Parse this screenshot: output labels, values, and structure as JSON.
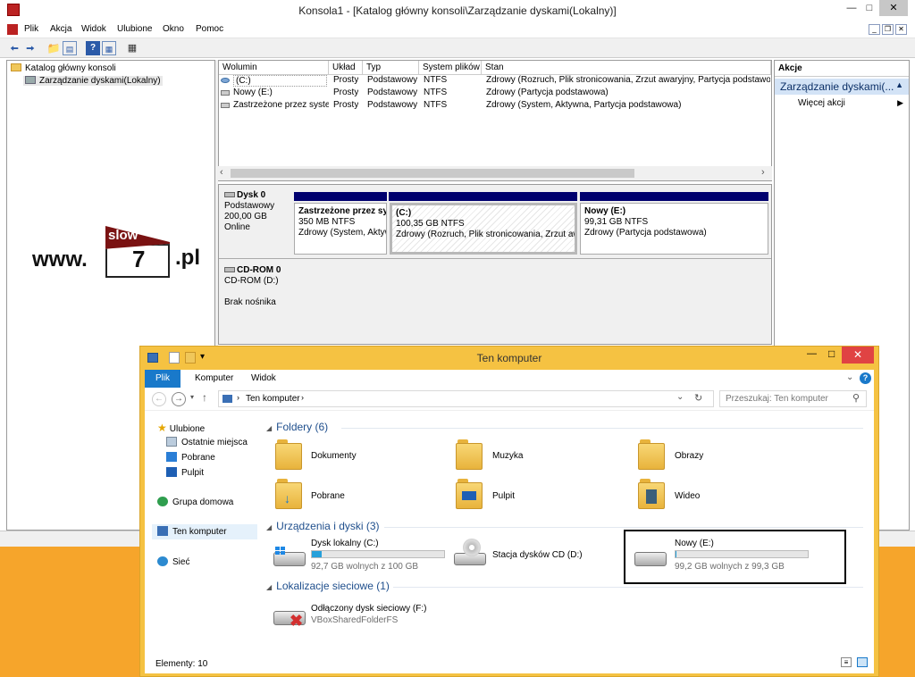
{
  "mmc": {
    "title": "Konsola1 - [Katalog główny konsoli\\Zarządzanie dyskami(Lokalny)]",
    "menu": [
      "Plik",
      "Akcja",
      "Widok",
      "Ulubione",
      "Okno",
      "Pomoc"
    ],
    "tree": {
      "root": "Katalog główny konsoli",
      "child": "Zarządzanie dyskami(Lokalny)"
    },
    "columns": [
      "Wolumin",
      "Układ",
      "Typ",
      "System plików",
      "Stan"
    ],
    "volumes": [
      {
        "name": "(C:)",
        "layout": "Prosty",
        "type": "Podstawowy",
        "fs": "NTFS",
        "status": "Zdrowy (Rozruch, Plik stronicowania, Zrzut awaryjny, Partycja podstawowa)"
      },
      {
        "name": "Nowy (E:)",
        "layout": "Prosty",
        "type": "Podstawowy",
        "fs": "NTFS",
        "status": "Zdrowy (Partycja podstawowa)"
      },
      {
        "name": "Zastrzeżone przez system",
        "layout": "Prosty",
        "type": "Podstawowy",
        "fs": "NTFS",
        "status": "Zdrowy (System, Aktywna, Partycja podstawowa)"
      }
    ],
    "disk0": {
      "name": "Dysk 0",
      "type": "Podstawowy",
      "size": "200,00 GB",
      "state": "Online",
      "partitions": [
        {
          "title": "Zastrzeżone przez sys",
          "size": "350 MB NTFS",
          "status": "Zdrowy (System, Aktyw"
        },
        {
          "title": "(C:)",
          "size": "100,35 GB NTFS",
          "status": "Zdrowy (Rozruch, Plik stronicowania, Zrzut awa"
        },
        {
          "title": "Nowy  (E:)",
          "size": "99,31 GB NTFS",
          "status": "Zdrowy (Partycja podstawowa)"
        }
      ]
    },
    "cdrom": {
      "name": "CD-ROM 0",
      "drive": "CD-ROM (D:)",
      "media": "Brak nośnika"
    },
    "actions": {
      "header": "Akcje",
      "selected": "Zarządzanie dyskami(...",
      "more": "Więcej akcji"
    }
  },
  "watermark": {
    "prefix": "www.",
    "top": "slow",
    "number": "7",
    "suffix": ".pl"
  },
  "explorer": {
    "title": "Ten komputer",
    "tabs": [
      "Plik",
      "Komputer",
      "Widok"
    ],
    "address": "Ten komputer",
    "search_placeholder": "Przeszukaj: Ten komputer",
    "nav": {
      "favorites": "Ulubione",
      "recent": "Ostatnie miejsca",
      "downloads": "Pobrane",
      "desktop": "Pulpit",
      "homegroup": "Grupa domowa",
      "thispc": "Ten komputer",
      "network": "Sieć"
    },
    "folders_header": "Foldery (6)",
    "folders": [
      "Dokumenty",
      "Muzyka",
      "Obrazy",
      "Pobrane",
      "Pulpit",
      "Wideo"
    ],
    "devices_header": "Urządzenia i dyski (3)",
    "devices": [
      {
        "name": "Dysk lokalny (C:)",
        "free": "92,7 GB wolnych z 100 GB",
        "used_fraction": 0.073
      },
      {
        "name": "Stacja dysków CD (D:)"
      },
      {
        "name": "Nowy (E:)",
        "free": "99,2 GB wolnych z 99,3 GB",
        "used_fraction": 0.001
      }
    ],
    "network_header": "Lokalizacje sieciowe (1)",
    "network_drive": {
      "name": "Odłączony dysk sieciowy (F:)",
      "path": "VBoxSharedFolderFS"
    },
    "status": "Elementy: 10"
  },
  "colors": {
    "partition_header": "#00006e",
    "explorer_frame": "#f5c242",
    "desktop": "#f6a52b",
    "accent": "#26a0da",
    "close": "#e04343"
  }
}
